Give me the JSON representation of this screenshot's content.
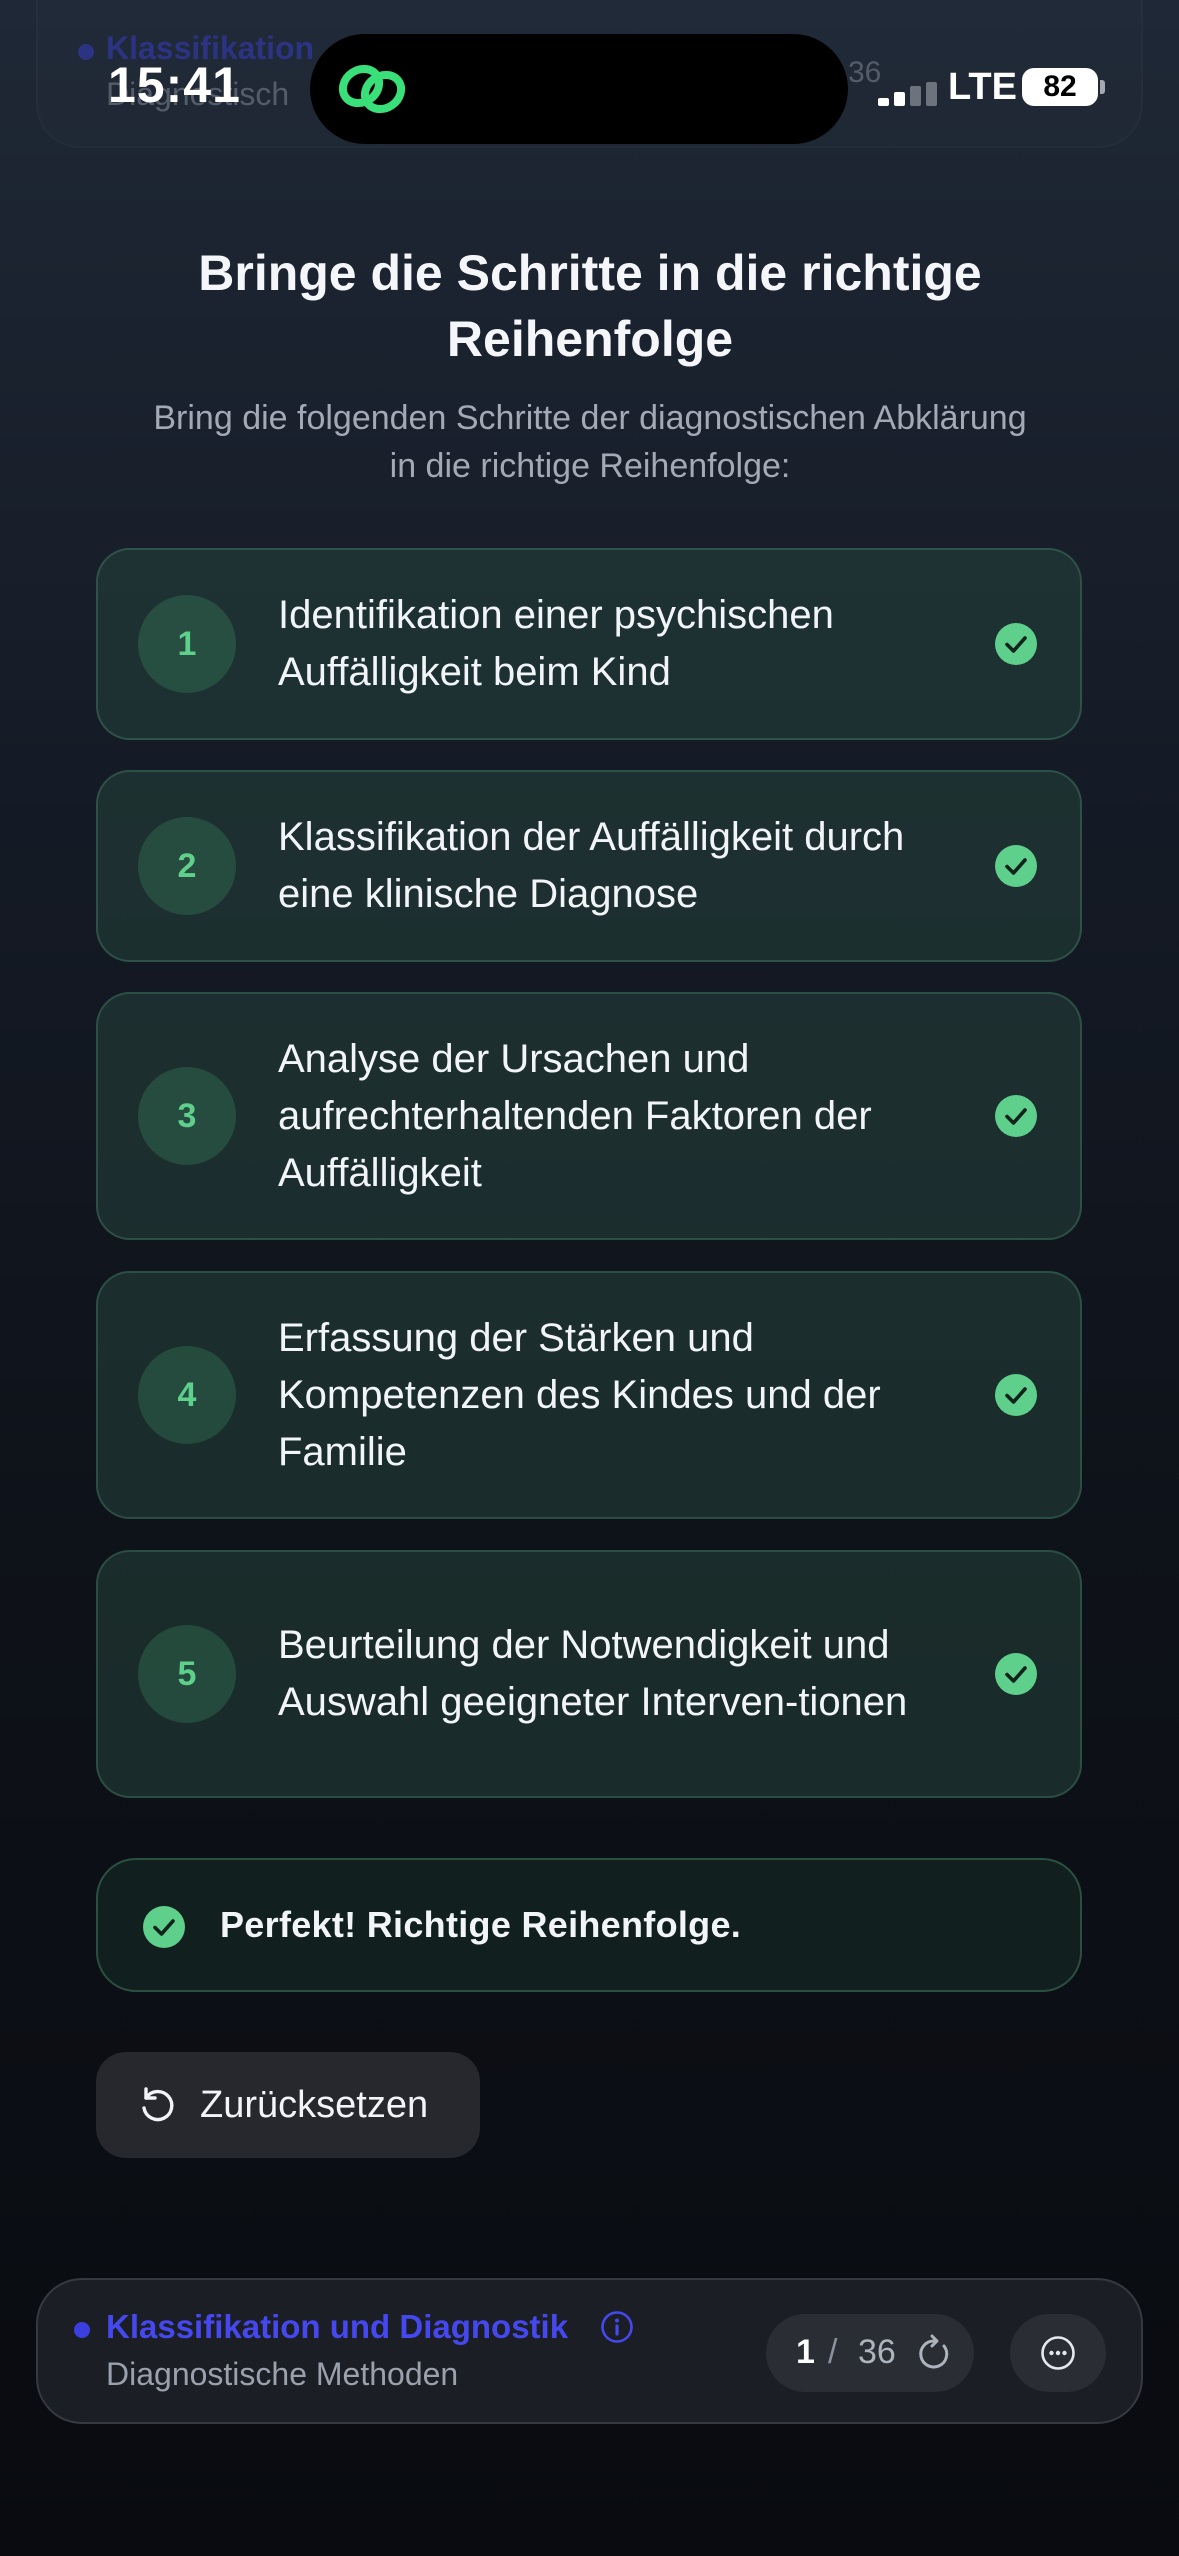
{
  "status_bar": {
    "time": "15:41",
    "network": "LTE",
    "battery": "82"
  },
  "header": {
    "title": "Bringe die Schritte in die richtige Reihenfolge",
    "instruction": "Bring die folgenden Schritte der diagnostischen Abklärung in die richtige Reihenfolge:"
  },
  "steps": [
    {
      "number": "1",
      "text": "Identifikation einer psychischen Auffälligkeit beim Kind"
    },
    {
      "number": "2",
      "text": "Klassifikation der Auffälligkeit durch eine klinische Diagnose"
    },
    {
      "number": "3",
      "text": "Analyse der Ursachen und aufrechterhaltenden Faktoren der Auffälligkeit"
    },
    {
      "number": "4",
      "text": "Erfassung der Stärken und Kompetenzen des Kindes und der Familie"
    },
    {
      "number": "5",
      "text": "Beurteilung der Notwendigkeit und Auswahl geeigneter Interven-tionen"
    }
  ],
  "feedback": {
    "message": "Perfekt! Richtige Reihenfolge."
  },
  "actions": {
    "reset_label": "Zurücksetzen"
  },
  "bottom_bar": {
    "topic": "Klassifikation und Diagnostik",
    "subtopic": "Diagnostische Methoden",
    "current": "1",
    "separator": "/",
    "total": "36"
  },
  "ghost_bar": {
    "topic": "Klassifikation",
    "subtopic": "Diagnostisch",
    "total": "36"
  },
  "colors": {
    "accent_green": "#5fcf8c",
    "topic_blue": "#4548ee"
  }
}
